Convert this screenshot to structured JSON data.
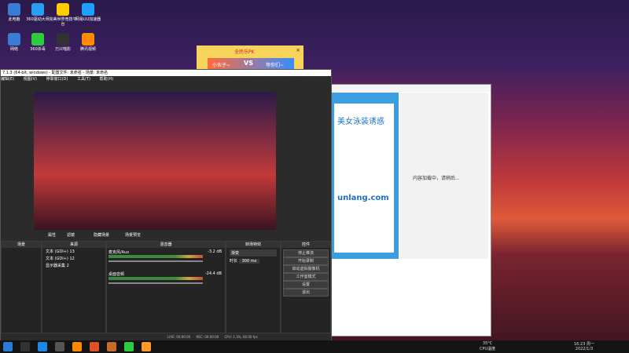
{
  "desktop_icons": [
    {
      "label": "此电脑",
      "color": "#3a7bd5"
    },
    {
      "label": "360驱动大师",
      "color": "#2a9ef0"
    },
    {
      "label": "完美世界竞技平台",
      "color": "#ffcc00"
    },
    {
      "label": "网易UU加速器",
      "color": "#1ea0ff"
    },
    {
      "label": "网络",
      "color": "#3a7bd5"
    },
    {
      "label": "360杀毒",
      "color": "#2ecc40"
    },
    {
      "label": "万兴喵影",
      "color": "#333333"
    },
    {
      "label": "腾讯视频",
      "color": "#ff8a00"
    }
  ],
  "popup": {
    "title": "全民乐PK",
    "left": "小伙子~",
    "right": "等你们~"
  },
  "obs": {
    "title": "7.1.3 (64-bit, windows) - 配置文件: 未命名 - 场景: 未命名",
    "menus": [
      "编辑(E)",
      "视图(V)",
      "停靠窗口(D)",
      "工具(T)",
      "帮助(H)"
    ],
    "tabs": [
      "属性",
      "滤镜",
      "隐藏场景",
      "场景预览"
    ],
    "scene_panel": "场景",
    "source_panel": "来源",
    "sources": [
      "文本 (GDI+) 13",
      "文本 (GDI+) 12",
      "显示器采集 2"
    ],
    "mixer_panel": "混音器",
    "mixer_tracks": [
      {
        "name": "麦克风/Aux",
        "db": "-3.2 dB"
      },
      {
        "name": "桌面音频",
        "db": "-24.4 dB"
      }
    ],
    "transition_panel": "转场特效",
    "transition_name": "渐变",
    "duration_label": "时长",
    "duration_value": "300 ms",
    "controls_panel": "控件",
    "controls": [
      "停止推流",
      "开始录制",
      "启动虚拟摄像机",
      "工作室模式",
      "设置",
      "退出"
    ],
    "status": {
      "live": "LIVE: 00:00:00",
      "rec": "REC: 00:00:00",
      "cpu": "CPU: 1.3%, 60.00 fps"
    }
  },
  "browser": {
    "header_text": "美女泳装诱惑",
    "site_text": "unlang.com",
    "loading": "内容加载中，请稍后..."
  },
  "taskbar": {
    "temp": "35°C",
    "cpu_label": "CPU温度",
    "time": "16:23 周一",
    "date": "2022/1/3"
  }
}
